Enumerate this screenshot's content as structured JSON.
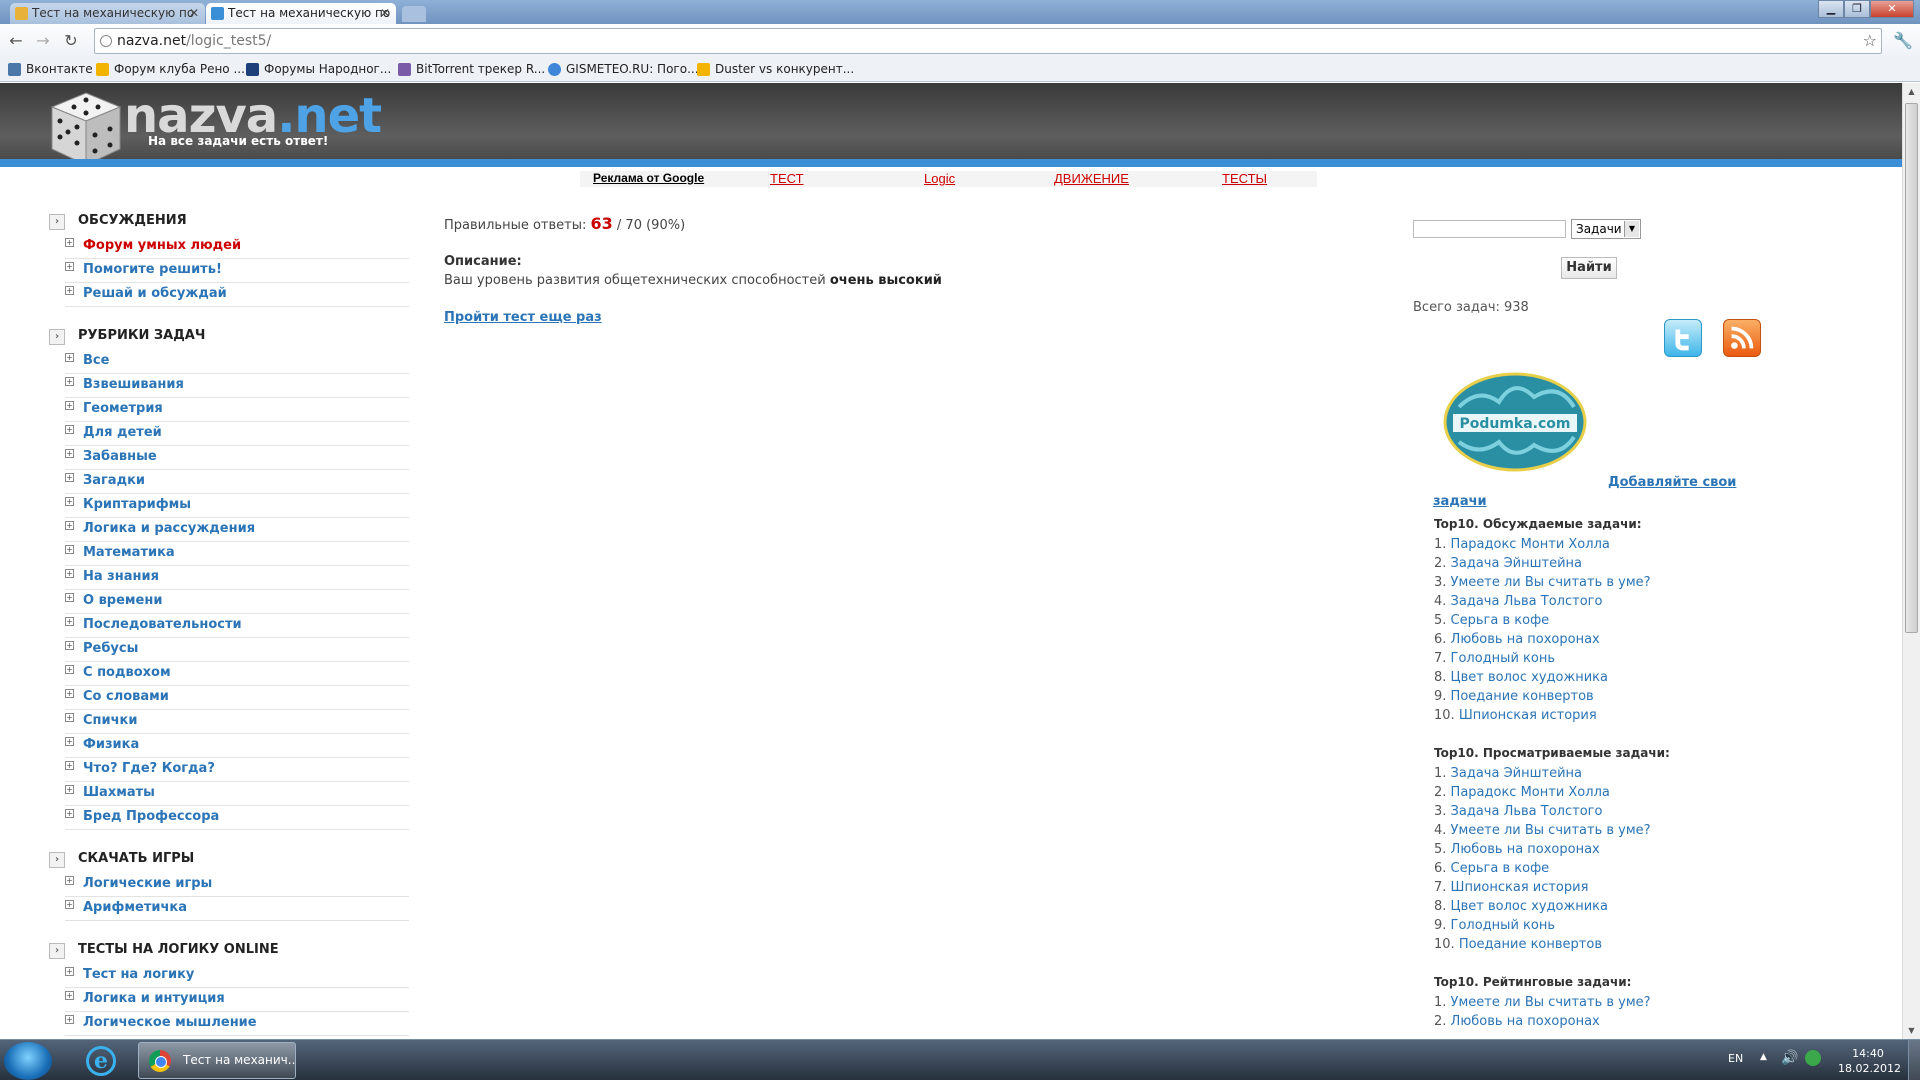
{
  "browser": {
    "tabs": [
      {
        "title": "Тест на механическую по"
      },
      {
        "title": "Тест на механическую по"
      }
    ],
    "url_host": "nazva.net",
    "url_path": "/logic_test5/",
    "bookmarks": [
      {
        "label": "Вконтакте",
        "color": "#4a76a8"
      },
      {
        "label": "Форум клуба Рено ...",
        "color": "#f2b400"
      },
      {
        "label": "Форумы Народног...",
        "color": "#1d3f7a"
      },
      {
        "label": "BitTorrent трекер R...",
        "color": "#7a5ba8"
      },
      {
        "label": "GISMETEO.RU: Пого...",
        "color": "#3f86d9"
      },
      {
        "label": "Duster vs конкурент...",
        "color": "#f2b400"
      }
    ]
  },
  "site": {
    "logo_name": "nazva",
    "logo_tld": ".net",
    "tagline": "На все задачи есть ответ!",
    "topnav": {
      "ads": "Реклама от Google",
      "links": [
        "ТЕСТ",
        "Logic",
        "ДВИЖЕНИЕ",
        "ТЕСТЫ"
      ]
    }
  },
  "sidebar": {
    "sections": [
      {
        "title": "ОБСУЖДЕНИЯ",
        "items": [
          "Форум умных людей",
          "Помогите решить!",
          "Решай и обсуждай"
        ]
      },
      {
        "title": "РУБРИКИ ЗАДАЧ",
        "items": [
          "Все",
          "Взвешивания",
          "Геометрия",
          "Для детей",
          "Забавные",
          "Загадки",
          "Криптарифмы",
          "Логика и рассуждения",
          "Математика",
          "На знания",
          "О времени",
          "Последовательности",
          "Ребусы",
          "С подвохом",
          "Со словами",
          "Спички",
          "Физика",
          "Что? Где? Когда?",
          "Шахматы",
          "Бред Профессора"
        ]
      },
      {
        "title": "СКАЧАТЬ ИГРЫ",
        "items": [
          "Логические игры",
          "Арифметичка"
        ]
      },
      {
        "title": "ТЕСТЫ НА ЛОГИКУ ONLINE",
        "items": [
          "Тест на логику",
          "Логика и интуиция",
          "Логическое мышление"
        ]
      }
    ]
  },
  "result": {
    "label": "Правильные ответы:",
    "correct": "63",
    "total": "/ 70 (90%)",
    "desc_heading": "Описание:",
    "desc_text": "Ваш уровень развития общетехнических способностей",
    "desc_level": "очень высокий",
    "retry": "Пройти тест еще раз"
  },
  "right": {
    "search_placeholder": "",
    "select_value": "Задачи",
    "search_button": "Найти",
    "total_tasks": "Всего задач: 938",
    "podumka_text": "Podumka.com",
    "add_tasks": "Добавляйте свои задачи",
    "top_discussed": {
      "title": "Top10. Обсуждаемые задачи:",
      "items": [
        "Парадокс Монти Холла",
        "Задача Эйнштейна",
        "Умеете ли Вы считать в уме?",
        "Задача Льва Толстого",
        "Серьга в кофе",
        "Любовь на похоронах",
        "Голодный конь",
        "Цвет волос художника",
        "Поедание конвертов",
        "Шпионская история"
      ]
    },
    "top_viewed": {
      "title": "Top10. Просматриваемые задачи:",
      "items": [
        "Задача Эйнштейна",
        "Парадокс Монти Холла",
        "Задача Льва Толстого",
        "Умеете ли Вы считать в уме?",
        "Любовь на похоронах",
        "Серьга в кофе",
        "Шпионская история",
        "Цвет волос художника",
        "Голодный конь",
        "Поедание конвертов"
      ]
    },
    "top_rated": {
      "title": "Top10. Рейтинговые задачи:",
      "items": [
        "Умеете ли Вы считать в уме?",
        "Любовь на похоронах"
      ]
    }
  },
  "taskbar": {
    "chrome_title": "Тест на механич...",
    "lang": "EN",
    "time": "14:40",
    "date": "18.02.2012"
  }
}
